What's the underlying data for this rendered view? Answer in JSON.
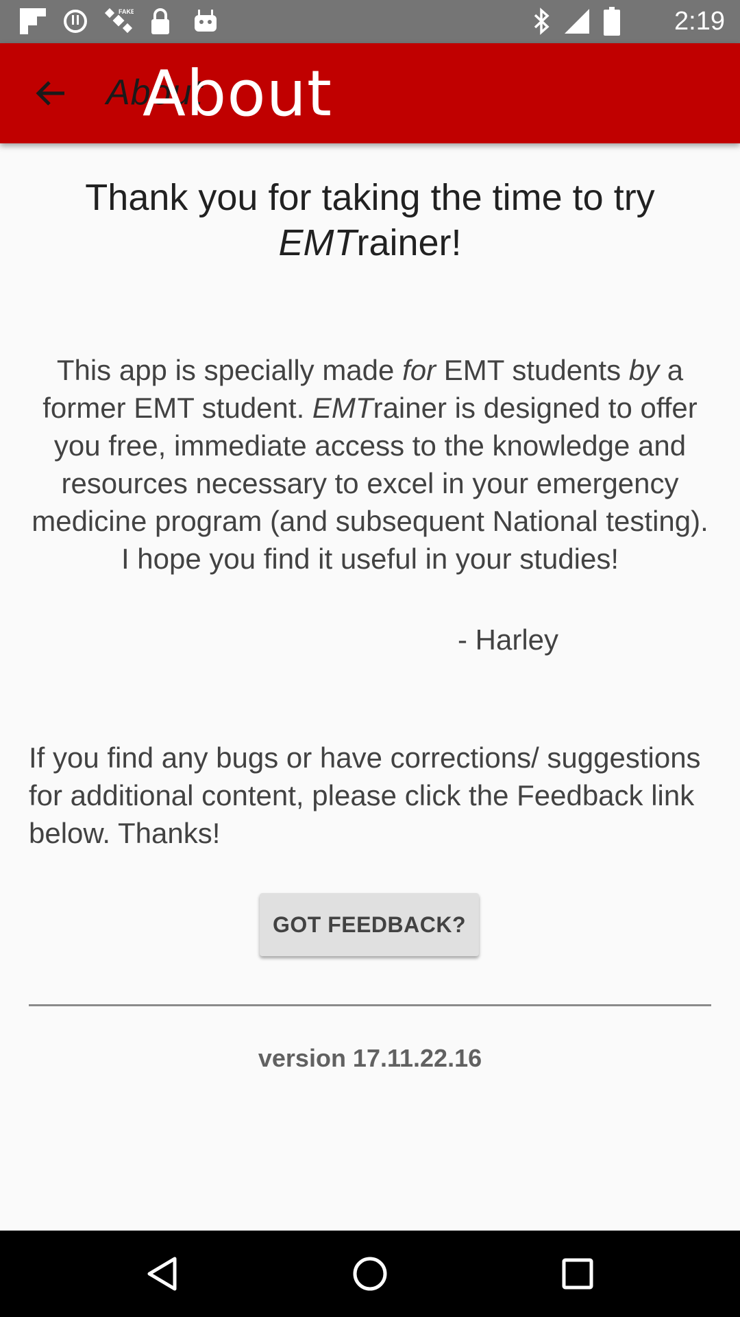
{
  "status_bar": {
    "time": "2:19",
    "left_icons": [
      "flipboard-icon",
      "alert-icon",
      "satellite-fake-icon",
      "lock-icon",
      "android-icon"
    ],
    "right_icons": [
      "bluetooth-icon",
      "signal-icon",
      "battery-icon"
    ]
  },
  "app_bar": {
    "title": "About",
    "title_overlay": "About",
    "color": "#c00000"
  },
  "content": {
    "heading_plain": "Thank you for taking the time to try ",
    "heading_italic": "EMT",
    "heading_end": "rainer!",
    "intro": {
      "p1": "This app is specially made ",
      "i1": "for",
      "p2": " EMT students ",
      "i2": "by",
      "p3": " a former EMT student. ",
      "i3": "EMT",
      "p4": "rainer is designed to offer you free, immediate access to the knowledge and resources necessary to excel in your emergency medicine program (and subsequent National testing). I hope you find it useful in your studies!"
    },
    "signature": "- Harley",
    "feedback_text": "If you find any bugs or have corrections/ suggestions for additional content, please click the Feedback link below. Thanks!",
    "feedback_button": "GOT FEEDBACK?",
    "version": "version 17.11.22.16"
  }
}
